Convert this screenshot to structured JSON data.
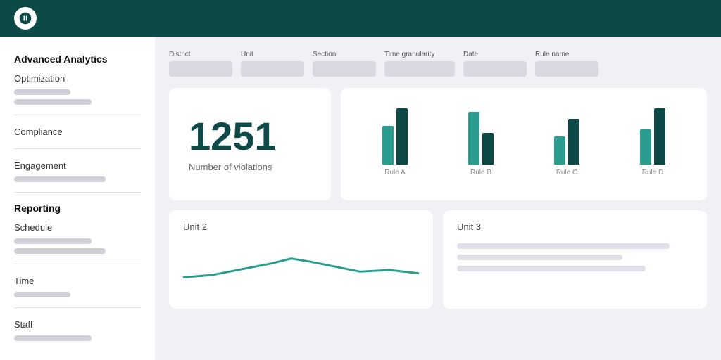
{
  "topnav": {
    "logo_alt": "App Logo"
  },
  "sidebar": {
    "section1_title": "Advanced Analytics",
    "item_optimization": "Optimization",
    "item_compliance": "Compliance",
    "item_engagement": "Engagement",
    "section2_title": "Reporting",
    "item_schedule": "Schedule",
    "item_time": "Time",
    "item_staff": "Staff"
  },
  "filters": {
    "district_label": "District",
    "unit_label": "Unit",
    "section_label": "Section",
    "time_granularity_label": "Time granularity",
    "date_label": "Date",
    "rule_name_label": "Rule name"
  },
  "kpi": {
    "number": "1251",
    "label": "Number of violations"
  },
  "barchart": {
    "groups": [
      {
        "label": "Rule A",
        "bar1_height": 55,
        "bar2_height": 80
      },
      {
        "label": "Rule B",
        "bar1_height": 75,
        "bar2_height": 45
      },
      {
        "label": "Rule C",
        "bar1_height": 40,
        "bar2_height": 65
      },
      {
        "label": "Rule D",
        "bar1_height": 50,
        "bar2_height": 80
      }
    ]
  },
  "unit2": {
    "title": "Unit 2"
  },
  "unit3": {
    "title": "Unit 3"
  },
  "colors": {
    "teal": "#2a9d8f",
    "dark_teal": "#0d4a47",
    "accent": "#2a9d8f"
  }
}
